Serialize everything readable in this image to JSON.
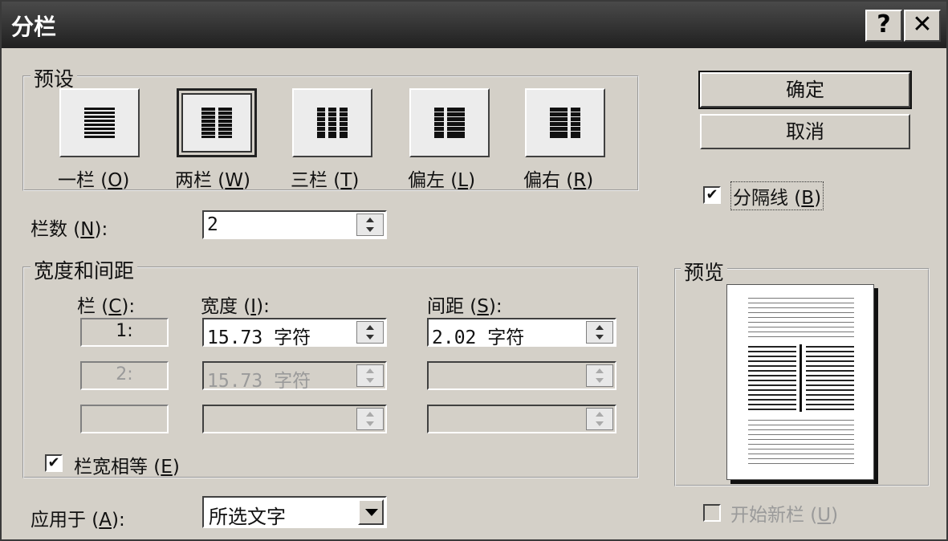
{
  "window": {
    "title": "分栏",
    "help_glyph": "?",
    "close_glyph": "✕"
  },
  "presets": {
    "label": "预设",
    "items": [
      {
        "name": "一栏",
        "key": "O",
        "selected": false
      },
      {
        "name": "两栏",
        "key": "W",
        "selected": true
      },
      {
        "name": "三栏",
        "key": "T",
        "selected": false
      },
      {
        "name": "偏左",
        "key": "L",
        "selected": false
      },
      {
        "name": "偏右",
        "key": "R",
        "selected": false
      }
    ]
  },
  "columns_count": {
    "label": "栏数",
    "key": "N",
    "suffix": "):",
    "value": "2"
  },
  "width_spacing": {
    "label": "宽度和间距",
    "col_header": "栏",
    "col_key": "C",
    "width_header": "宽度",
    "width_key": "I",
    "spacing_header": "间距",
    "spacing_key": "S",
    "header_suffix": "):",
    "rows": [
      {
        "num": "1:",
        "width": "15.73 字符",
        "spacing": "2.02 字符",
        "enabled": true
      },
      {
        "num": "2:",
        "width": "15.73 字符",
        "spacing": "",
        "enabled": false
      },
      {
        "num": "",
        "width": "",
        "spacing": "",
        "enabled": false
      }
    ]
  },
  "equal_width": {
    "label": "栏宽相等",
    "key": "E",
    "checked": true
  },
  "apply_to": {
    "label": "应用于",
    "key": "A",
    "value": "所选文字"
  },
  "buttons": {
    "ok": "确定",
    "cancel": "取消"
  },
  "separator": {
    "label": "分隔线",
    "key": "B",
    "checked": true
  },
  "preview": {
    "label": "预览"
  },
  "new_column": {
    "label": "开始新栏",
    "key": "U",
    "checked": false,
    "enabled": false
  },
  "check_glyph": "✔",
  "colors": {
    "dialog_bg": "#d4d0c8",
    "titlebar": "#2a2a2a"
  }
}
